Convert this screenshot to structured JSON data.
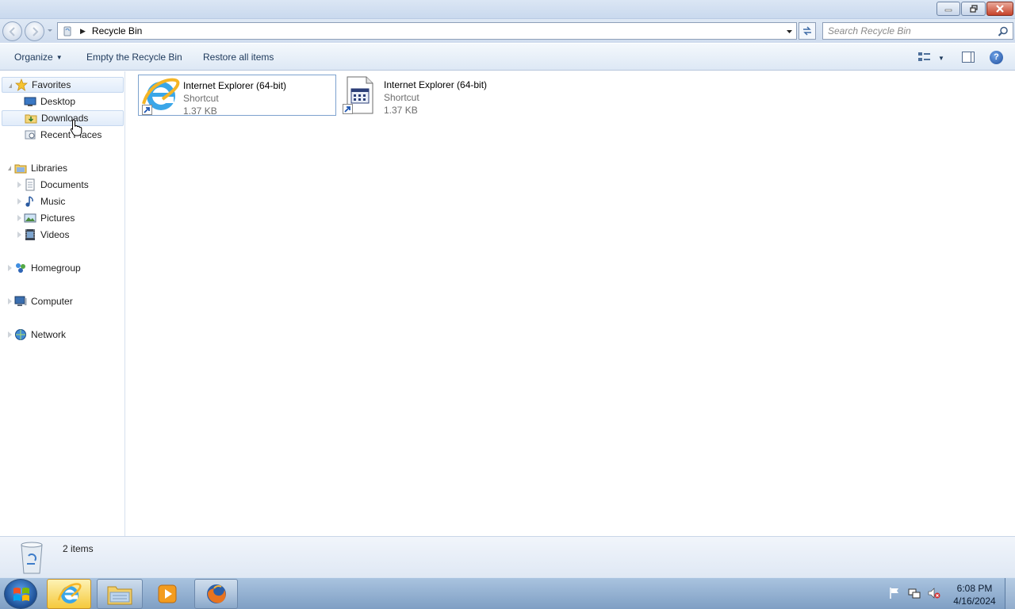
{
  "window": {
    "controls": {
      "minimize": "minimize",
      "maximize": "restore",
      "close": "close"
    }
  },
  "address": {
    "location": "Recycle Bin",
    "search_placeholder": "Search Recycle Bin"
  },
  "toolbar": {
    "organize_label": "Organize",
    "empty_label": "Empty the Recycle Bin",
    "restore_label": "Restore all items",
    "help_label": "?"
  },
  "nav": {
    "favorites": {
      "label": "Favorites",
      "items": [
        {
          "label": "Desktop"
        },
        {
          "label": "Downloads"
        },
        {
          "label": "Recent Places"
        }
      ]
    },
    "libraries": {
      "label": "Libraries",
      "items": [
        {
          "label": "Documents"
        },
        {
          "label": "Music"
        },
        {
          "label": "Pictures"
        },
        {
          "label": "Videos"
        }
      ]
    },
    "homegroup": {
      "label": "Homegroup"
    },
    "computer": {
      "label": "Computer"
    },
    "network": {
      "label": "Network"
    }
  },
  "files": [
    {
      "name": "Internet Explorer (64-bit)",
      "type": "Shortcut",
      "size": "1.37 KB",
      "icon": "ie-icon"
    },
    {
      "name": "Internet Explorer (64-bit)",
      "type": "Shortcut",
      "size": "1.37 KB",
      "icon": "generic-app-icon"
    }
  ],
  "details": {
    "item_count": "2 items"
  },
  "taskbar": {
    "clock_time": "6:08 PM",
    "clock_date": "4/16/2024",
    "pinned": [
      "internet-explorer",
      "windows-explorer",
      "windows-media-player",
      "firefox"
    ]
  },
  "colors": {
    "accent": "#1e395b",
    "selection": "#7da2ce",
    "taskbar": "#8fabcf"
  }
}
